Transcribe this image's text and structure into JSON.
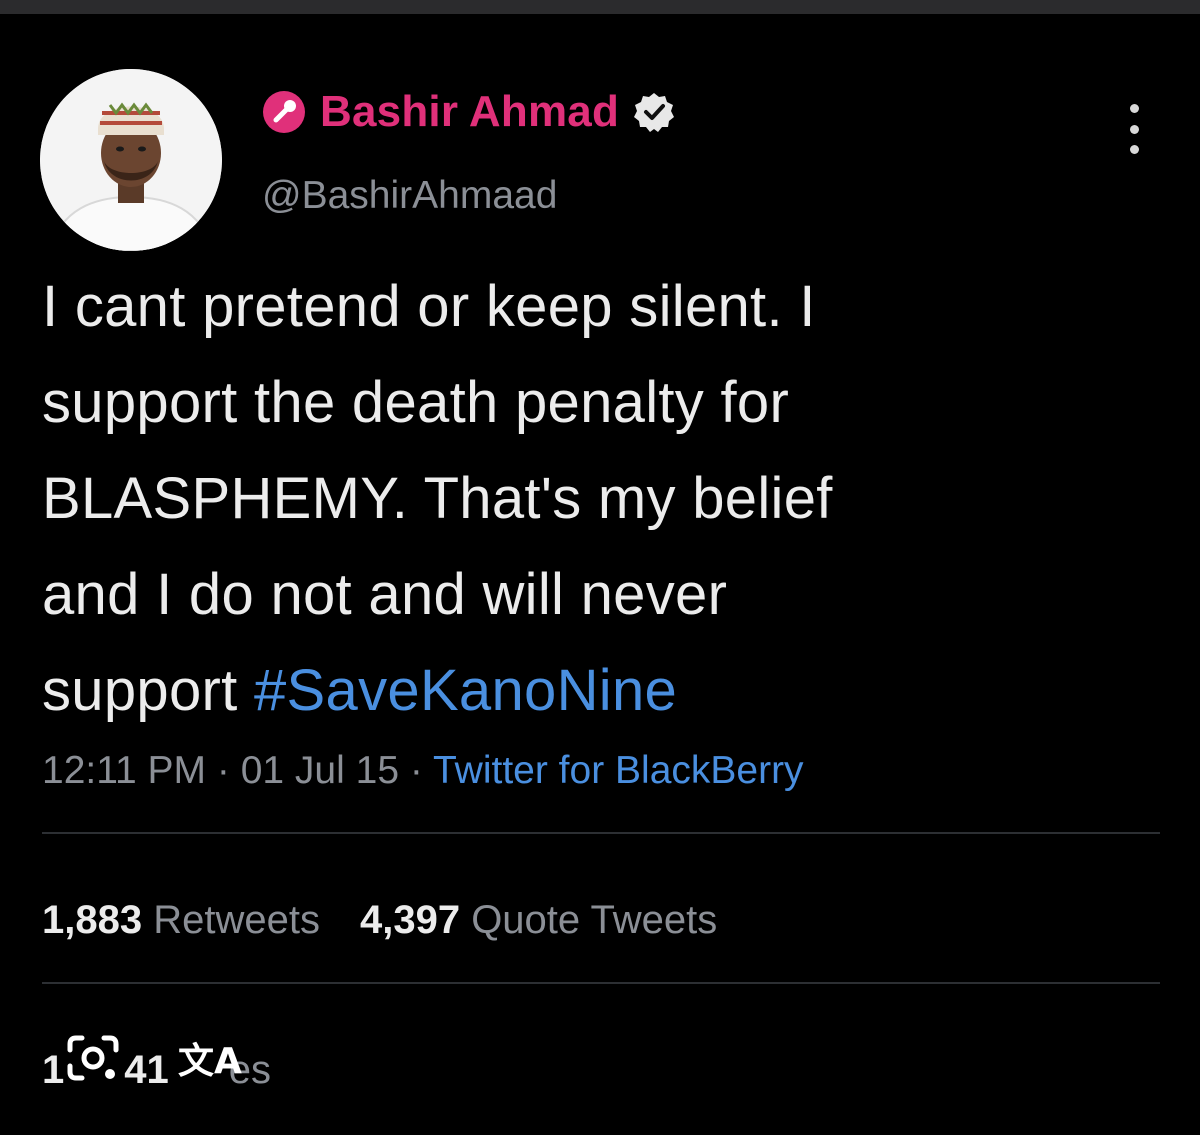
{
  "author": {
    "display_name": "Bashir Ahmad",
    "handle": "@BashirAhmaad",
    "name_color": "#e0307a",
    "badge_color": "#e0307a"
  },
  "tweet": {
    "lines": [
      "I cant pretend or keep silent. I",
      "support the death penalty for",
      "BLASPHEMY. That's my belief",
      "and I do not and will never"
    ],
    "last_line_prefix": "support ",
    "hashtag": "#SaveKanoNine",
    "time": "12:11 PM",
    "date": "01 Jul 15",
    "source": "Twitter for BlackBerry",
    "separator": " · "
  },
  "stats": {
    "retweets_count": "1,883",
    "retweets_label": " Retweets",
    "quotes_count": "4,397",
    "quotes_label": " Quote Tweets",
    "likes_count_partial": "1",
    "likes_count_tail": "41",
    "likes_label_tail": "es"
  },
  "overlay": {
    "translate_glyph": "文A"
  },
  "icons": {
    "more": "more-vertical-icon",
    "verified": "verified-badge-icon",
    "badge": "microphone-badge-icon",
    "lens": "google-lens-icon",
    "translate": "translate-icon"
  }
}
